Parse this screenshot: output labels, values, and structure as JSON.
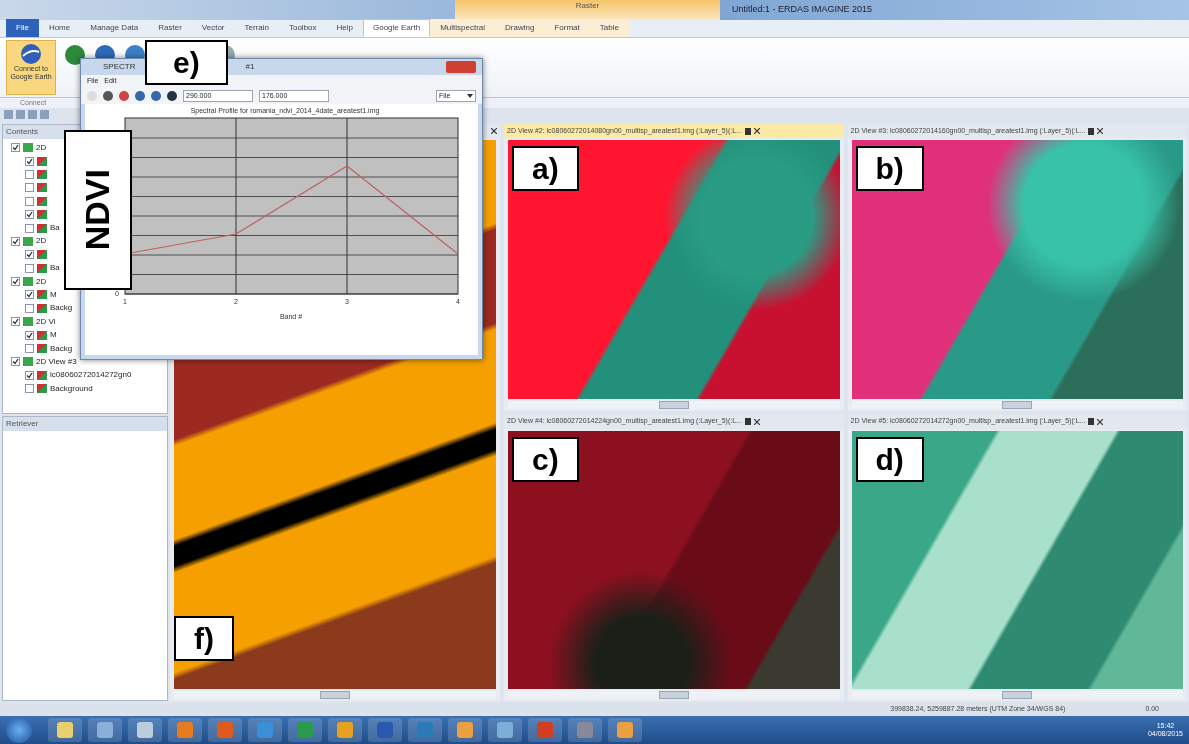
{
  "window": {
    "title": "Untitled:1 - ERDAS IMAGINE 2015",
    "context_group": "Raster"
  },
  "ribbon_tabs": [
    {
      "label": "File",
      "kind": "file",
      "selected": false
    },
    {
      "label": "Home",
      "kind": "tab",
      "selected": false
    },
    {
      "label": "Manage Data",
      "kind": "tab",
      "selected": false
    },
    {
      "label": "Raster",
      "kind": "tab",
      "selected": false
    },
    {
      "label": "Vector",
      "kind": "tab",
      "selected": false
    },
    {
      "label": "Terrain",
      "kind": "tab",
      "selected": false
    },
    {
      "label": "Toolbox",
      "kind": "tab",
      "selected": false
    },
    {
      "label": "Help",
      "kind": "tab",
      "selected": false
    },
    {
      "label": "Google Earth",
      "kind": "tab",
      "selected": true
    },
    {
      "label": "Multispectral",
      "kind": "context",
      "selected": false
    },
    {
      "label": "Drawing",
      "kind": "context",
      "selected": false
    },
    {
      "label": "Format",
      "kind": "context",
      "selected": false
    },
    {
      "label": "Table",
      "kind": "context",
      "selected": false
    }
  ],
  "ribbon": {
    "connect_button": "Connect to Google Earth",
    "group_label": "Connect"
  },
  "contents": {
    "title": "Contents",
    "tree": [
      {
        "label": "2D",
        "checked": true,
        "children": [
          {
            "checked": true
          },
          {
            "checked": false
          },
          {
            "checked": false
          },
          {
            "checked": false
          },
          {
            "checked": true
          },
          {
            "label": "Ba",
            "checked": false
          }
        ]
      },
      {
        "label": "2D",
        "checked": true,
        "children": [
          {
            "checked": true
          },
          {
            "label": "Ba",
            "checked": false
          }
        ]
      },
      {
        "label": "2D",
        "checked": true,
        "children": [
          {
            "label": "M",
            "checked": true
          },
          {
            "label": "Backg",
            "checked": false
          }
        ]
      },
      {
        "label": "2D Vi",
        "checked": true,
        "children": [
          {
            "label": "M",
            "checked": true
          },
          {
            "label": "Backg",
            "checked": false
          }
        ]
      },
      {
        "label": "2D View #3",
        "checked": true,
        "children": [
          {
            "label": "lc08060272014272gn0",
            "checked": true
          },
          {
            "label": "Background",
            "checked": false
          }
        ]
      }
    ]
  },
  "retriever": {
    "title": "Retriever"
  },
  "spectral_window": {
    "title": "SPECTR",
    "title_tail": "#1",
    "menu": [
      "File",
      "Edit"
    ],
    "x_field": "290.000",
    "y_field": "176.000",
    "dropdown": "File",
    "chart": {
      "title": "Spectral Profile for romania_ndvi_2014_4date_areatest1.img",
      "xlabel": "Band #",
      "xticks": [
        "1",
        "2",
        "3",
        "4"
      ],
      "ytick": "0"
    },
    "panel_label": "e)",
    "axis_label": "NDVI"
  },
  "map_view": {
    "panel_label": "f)"
  },
  "views": [
    {
      "title": "2D View #2: lc08060272014080gn00_multisp_areatest1.img (:Layer_5)(:L...",
      "selected": true,
      "panel_label": "a)",
      "kind": "red"
    },
    {
      "title": "2D View #3: lc08060272014160gn00_multisp_areatest1.img (:Layer_5)(:L...",
      "selected": false,
      "panel_label": "b)",
      "kind": "pink"
    },
    {
      "title": "2D View #4: lc08060272014224gn00_multisp_areatest1.img (:Layer_5)(:L...",
      "selected": false,
      "panel_label": "c)",
      "kind": "dark"
    },
    {
      "title": "2D View #5: lc08060272014272gn00_multisp_areatest1.img (:Layer_5)(:L...",
      "selected": false,
      "panel_label": "d)",
      "kind": "green"
    }
  ],
  "status_bar": {
    "coordinates": "399838.24, 5259887.28 meters (UTM Zone 34/WGS 84)",
    "value": "0.00"
  },
  "taskbar": {
    "time": "15:42",
    "date": "04/08/2015"
  }
}
